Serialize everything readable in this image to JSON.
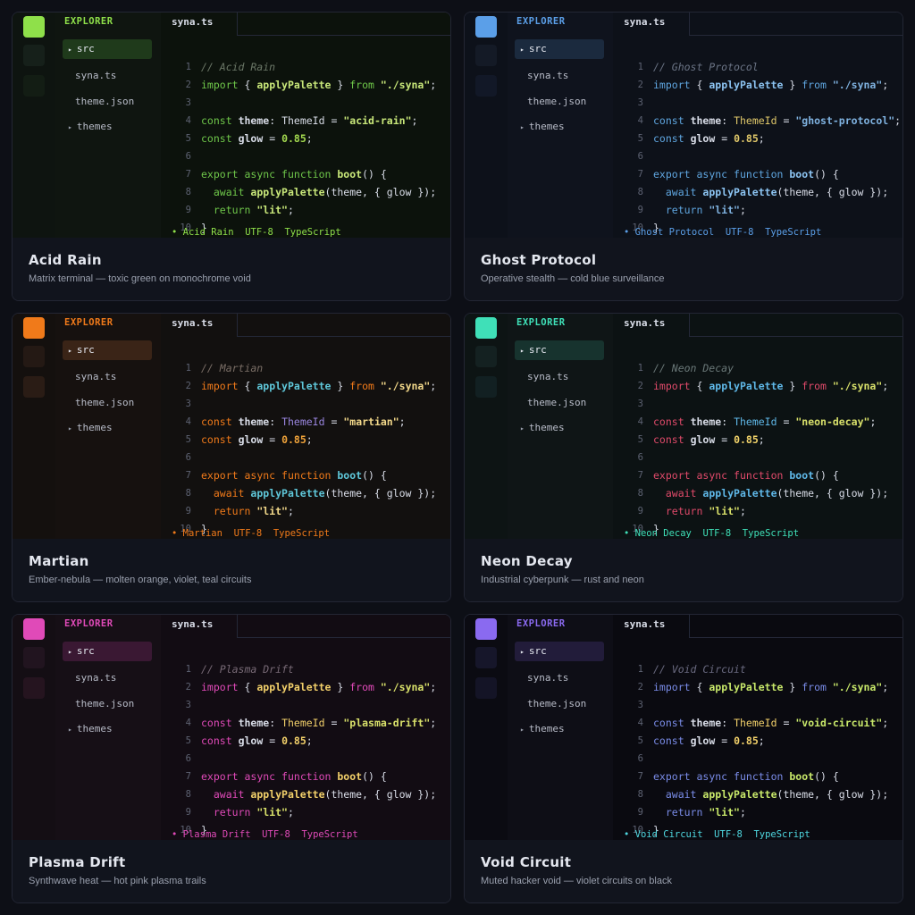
{
  "explorer_label": "EXPLORER",
  "files": {
    "src": "src",
    "syna": "syna.ts",
    "theme": "theme.json",
    "themes": "themes"
  },
  "tab_label": "syna.ts",
  "code_tokens": {
    "import_kw": "import",
    "open_brace": "{ ",
    "fn_apply": "applyPalette",
    "close_brace": " }",
    "from_kw": "from",
    "module": "\"./syna\"",
    "semicolon": ";",
    "const_kw": "const",
    "theme_var": "theme",
    "colon": ":",
    "type_name": "ThemeId",
    "eq": "=",
    "glow_var": "glow",
    "glow_val": "0.85",
    "export_kw": "export",
    "async_kw": "async",
    "function_kw": "function",
    "boot_fn": "boot",
    "boot_sig": "() {",
    "await_kw": "await",
    "call_args": "(theme, { glow });",
    "return_kw": "return",
    "lit_str": "\"lit\"",
    "close": "}"
  },
  "status_suffix": {
    "encoding": "UTF-8",
    "language": "TypeScript"
  },
  "themes": [
    {
      "name": "Acid Rain",
      "desc": "Matrix terminal — toxic green on monochrome void",
      "comment": "// Acid Rain",
      "id_str": "\"acid-rain\"",
      "colors": {
        "accent": "#8fe04a",
        "rail": "#0e1410",
        "side": "#0f1510",
        "edit": "#0c120c",
        "sel": "#1f3a1b",
        "kw": "#6fc74a",
        "fn": "#c9e87a",
        "str": "#c9e87a",
        "num": "#a3d94f",
        "type": "#d9dde8",
        "var": "#d9dde8",
        "comment": "#6c7868",
        "status": "#8fe04a",
        "rail_b1": "#16201a",
        "rail_b2": "#131d14"
      },
      "swatches": [
        "#8fe04a",
        "#5fae3a",
        "#b7d98a",
        "#2f5d25",
        "#d9f0b8",
        "#8fe04a"
      ]
    },
    {
      "name": "Ghost Protocol",
      "desc": "Operative stealth — cold blue surveillance",
      "comment": "// Ghost Protocol",
      "id_str": "\"ghost-protocol\"",
      "colors": {
        "accent": "#5b9fe8",
        "rail": "#0d111a",
        "side": "#0f131d",
        "edit": "#0d1119",
        "sel": "#1b2a3e",
        "kw": "#5fa6e0",
        "fn": "#8cc4f2",
        "str": "#7fb2e0",
        "num": "#e0c86a",
        "type": "#e0c86a",
        "var": "#d9dde8",
        "comment": "#6a7384",
        "status": "#5b9fe8",
        "rail_b1": "#141a26",
        "rail_b2": "#121827"
      },
      "swatches": [
        "#5b9fe8",
        "#3d7bc2",
        "#7fb2e0",
        "#a8c9ea",
        "#e0c86a",
        "#5b9fe8"
      ]
    },
    {
      "name": "Martian",
      "desc": "Ember-nebula — molten orange, violet, teal circuits",
      "comment": "// Martian",
      "id_str": "\"martian\"",
      "colors": {
        "accent": "#f07a1a",
        "rail": "#14100e",
        "side": "#16110f",
        "edit": "#12100f",
        "sel": "#3a2417",
        "kw": "#f07a1a",
        "fn": "#5fc7d9",
        "str": "#f2d88a",
        "num": "#f0a33a",
        "type": "#9a86e0",
        "var": "#d9dde8",
        "comment": "#7a6e66",
        "status": "#f07a1a",
        "rail_b1": "#241914",
        "rail_b2": "#2a1c15"
      },
      "swatches": [
        "#f07a1a",
        "#e0952e",
        "#5fc7d9",
        "#3aa7a0",
        "#9a86e0",
        "#b48ee8"
      ]
    },
    {
      "name": "Neon Decay",
      "desc": "Industrial cyberpunk — rust and neon",
      "comment": "// Neon Decay",
      "id_str": "\"neon-decay\"",
      "colors": {
        "accent": "#3fe0b8",
        "rail": "#0d1414",
        "side": "#0f1516",
        "edit": "#0c1213",
        "sel": "#17332e",
        "kw": "#e04a6a",
        "fn": "#5fb8e8",
        "str": "#d8e06a",
        "num": "#f2d36a",
        "type": "#5fb8e8",
        "var": "#d9dde8",
        "comment": "#6a7878",
        "status": "#3fe0b8",
        "rail_b1": "#142121",
        "rail_b2": "#122022"
      },
      "swatches": [
        "#3fe0b8",
        "#e04a6a",
        "#2fb89a",
        "#5fb8e8",
        "#c07ae0",
        "#e04a6a"
      ]
    },
    {
      "name": "Plasma Drift",
      "desc": "Synthwave heat — hot pink plasma trails",
      "comment": "// Plasma Drift",
      "id_str": "\"plasma-drift\"",
      "colors": {
        "accent": "#e04ab8",
        "rail": "#140e14",
        "side": "#160f16",
        "edit": "#120c13",
        "sel": "#3a1833",
        "kw": "#e04ab8",
        "fn": "#f2d06a",
        "str": "#d8e06a",
        "num": "#f2d06a",
        "type": "#f2d06a",
        "var": "#d9dde8",
        "comment": "#786a76",
        "status": "#e04ab8",
        "rail_b1": "#21141f",
        "rail_b2": "#25141f"
      },
      "swatches": [
        "#e04ab8",
        "#c03a9a",
        "#5fc79a",
        "#e05a8a",
        "#e04ab8",
        "#c85aa8"
      ]
    },
    {
      "name": "Void Circuit",
      "desc": "Muted hacker void — violet circuits on black",
      "comment": "// Void Circuit",
      "id_str": "\"void-circuit\"",
      "colors": {
        "accent": "#8a6af0",
        "rail": "#0b0b12",
        "side": "#0e0e16",
        "edit": "#0a0a10",
        "sel": "#221c3a",
        "kw": "#7a8ce8",
        "fn": "#c8e86a",
        "str": "#c8e86a",
        "num": "#f2d06a",
        "type": "#f2d06a",
        "var": "#d9dde8",
        "comment": "#6a6a80",
        "status": "#4fd8e0",
        "rail_b1": "#16162a",
        "rail_b2": "#141426"
      },
      "swatches": [
        "#8a6af0",
        "#6a5ad0",
        "#4fd8e0",
        "#7a8ce8",
        "#8a6af0",
        "#5a4ab8"
      ]
    }
  ]
}
